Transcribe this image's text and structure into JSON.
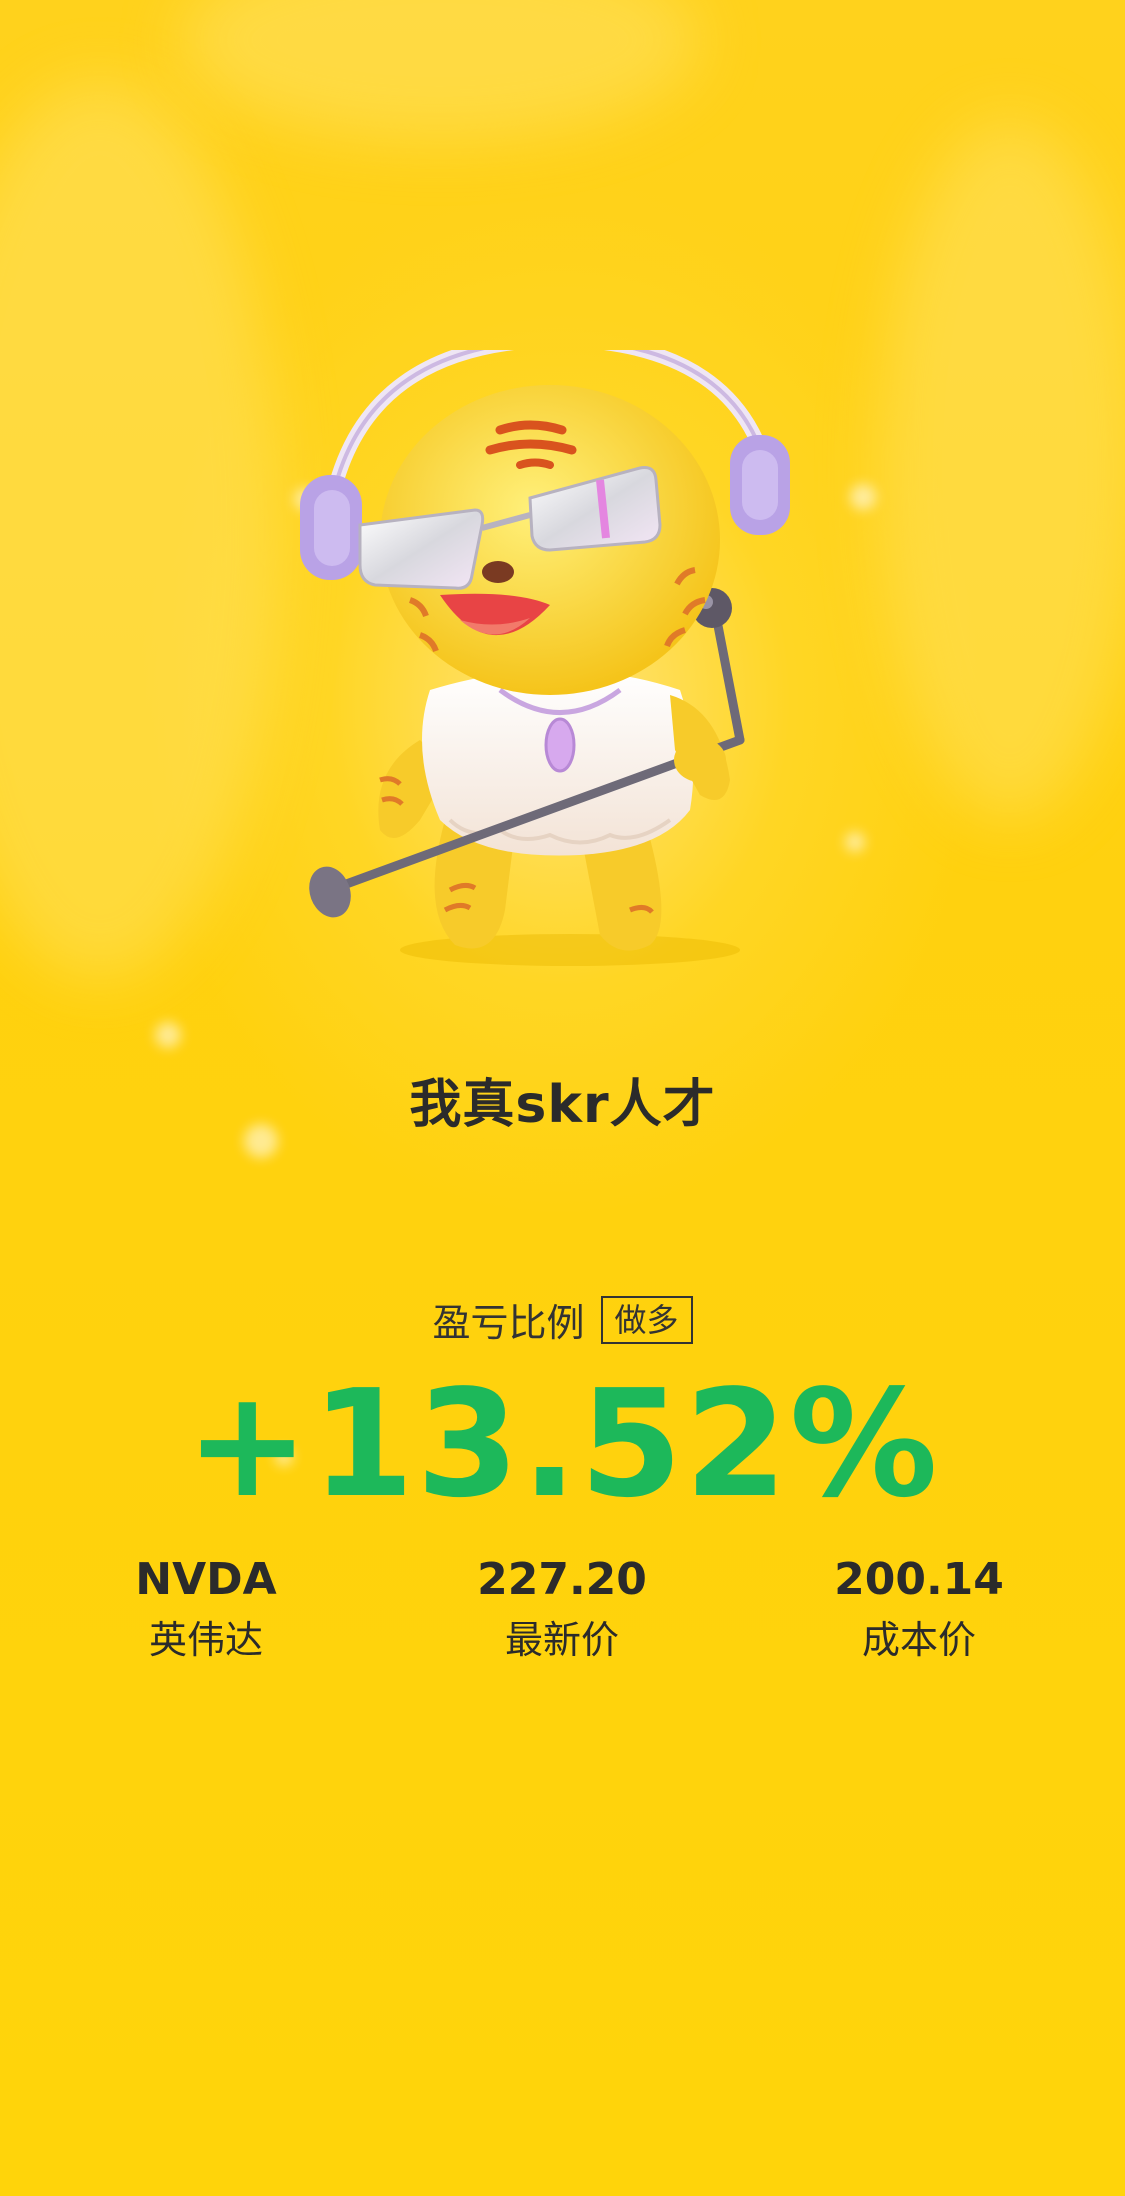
{
  "slogan": "我真skr人才",
  "profit_loss": {
    "label": "盈亏比例",
    "direction_tag": "做多",
    "value": "+13.52%"
  },
  "stats": [
    {
      "value": "NVDA",
      "label": "英伟达"
    },
    {
      "value": "227.20",
      "label": "最新价"
    },
    {
      "value": "200.14",
      "label": "成本价"
    }
  ],
  "colors": {
    "background": "#FFD21C",
    "profit_green": "#1DB85A",
    "text_dark": "#2B2B2B"
  },
  "mascot": {
    "icon": "tiger-mascot-with-headphones-and-microphone-icon"
  }
}
